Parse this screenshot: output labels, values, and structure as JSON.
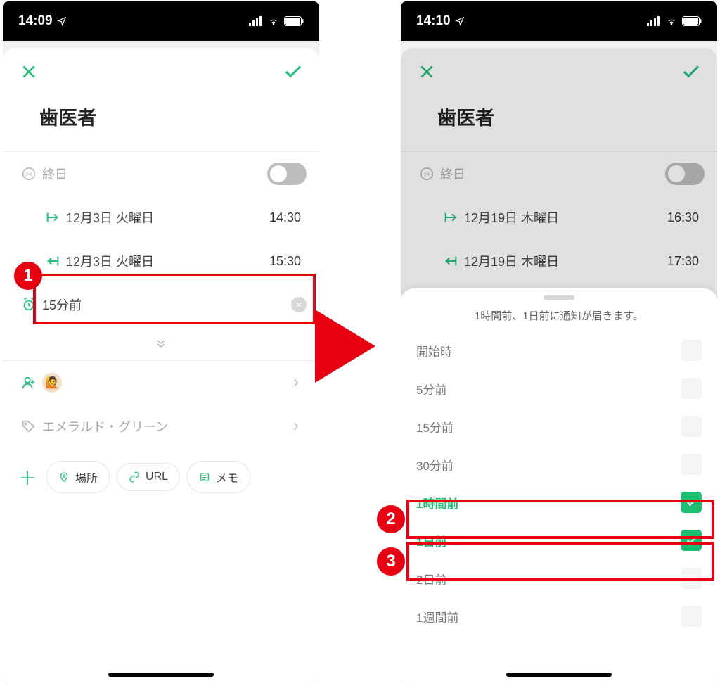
{
  "left": {
    "status_time": "14:09",
    "title": "歯医者",
    "allday_label": "終日",
    "start_date": "12月3日 火曜日",
    "start_time": "14:30",
    "end_date": "12月3日 火曜日",
    "end_time": "15:30",
    "reminder_value": "15分前",
    "color_label": "エメラルド・グリーン",
    "chip_place": "場所",
    "chip_url": "URL",
    "chip_memo": "メモ"
  },
  "right": {
    "status_time": "14:10",
    "title": "歯医者",
    "allday_label": "終日",
    "start_date": "12月19日 木曜日",
    "start_time": "16:30",
    "end_date": "12月19日 木曜日",
    "end_time": "17:30",
    "sheet_caption": "1時間前、1日前に通知が届きます。",
    "options": {
      "o0": "開始時",
      "o1": "5分前",
      "o2": "15分前",
      "o3": "30分前",
      "o4": "1時間前",
      "o5": "1日前",
      "o6": "2日前",
      "o7": "1週間前"
    }
  },
  "ann": {
    "b1": "1",
    "b2": "2",
    "b3": "3"
  }
}
